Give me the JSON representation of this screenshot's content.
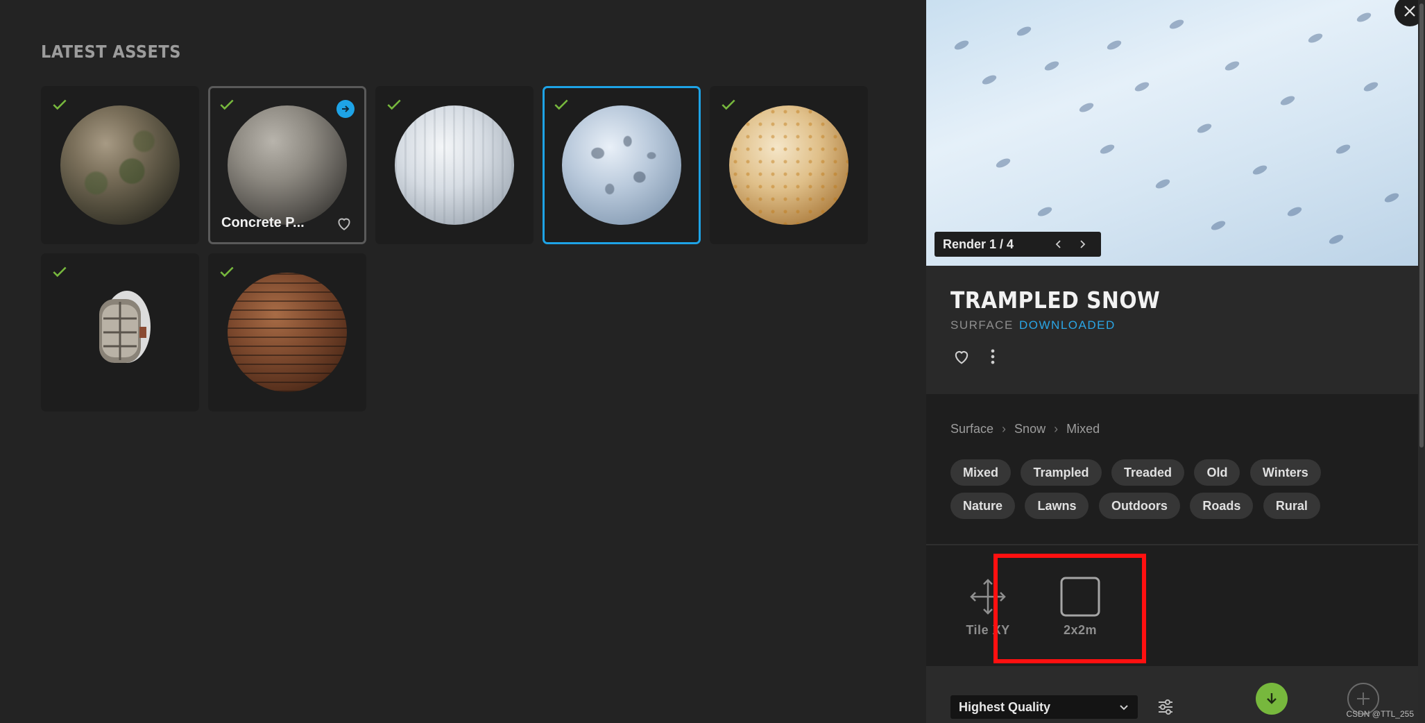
{
  "section": {
    "title": "LATEST ASSETS"
  },
  "assets": [
    {
      "name": "moss-stone",
      "label": "",
      "downloaded": true
    },
    {
      "name": "concrete",
      "label": "Concrete P...",
      "downloaded": true
    },
    {
      "name": "ice",
      "label": "",
      "downloaded": true
    },
    {
      "name": "trampled-snow",
      "label": "",
      "downloaded": true,
      "selected": true
    },
    {
      "name": "fabric",
      "label": "",
      "downloaded": true
    },
    {
      "name": "lamp",
      "label": "",
      "downloaded": true
    },
    {
      "name": "brick",
      "label": "",
      "downloaded": true
    }
  ],
  "preview": {
    "render_text": "Render 1 / 4"
  },
  "detail": {
    "title": "TRAMPLED SNOW",
    "type": "SURFACE",
    "status": "DOWNLOADED"
  },
  "breadcrumb": [
    "Surface",
    "Snow",
    "Mixed"
  ],
  "tags": [
    "Mixed",
    "Trampled",
    "Treaded",
    "Old",
    "Winters",
    "Nature",
    "Lawns",
    "Outdoors",
    "Roads",
    "Rural"
  ],
  "tools": {
    "tile_label": "Tile XY",
    "size_label": "2x2m"
  },
  "bottom": {
    "quality": "Highest Quality"
  },
  "watermark": "CSDN @TTL_255",
  "colors": {
    "accent": "#1ea3e6",
    "check": "#77b83d",
    "download": "#77b83d",
    "highlight": "#ff1010"
  }
}
